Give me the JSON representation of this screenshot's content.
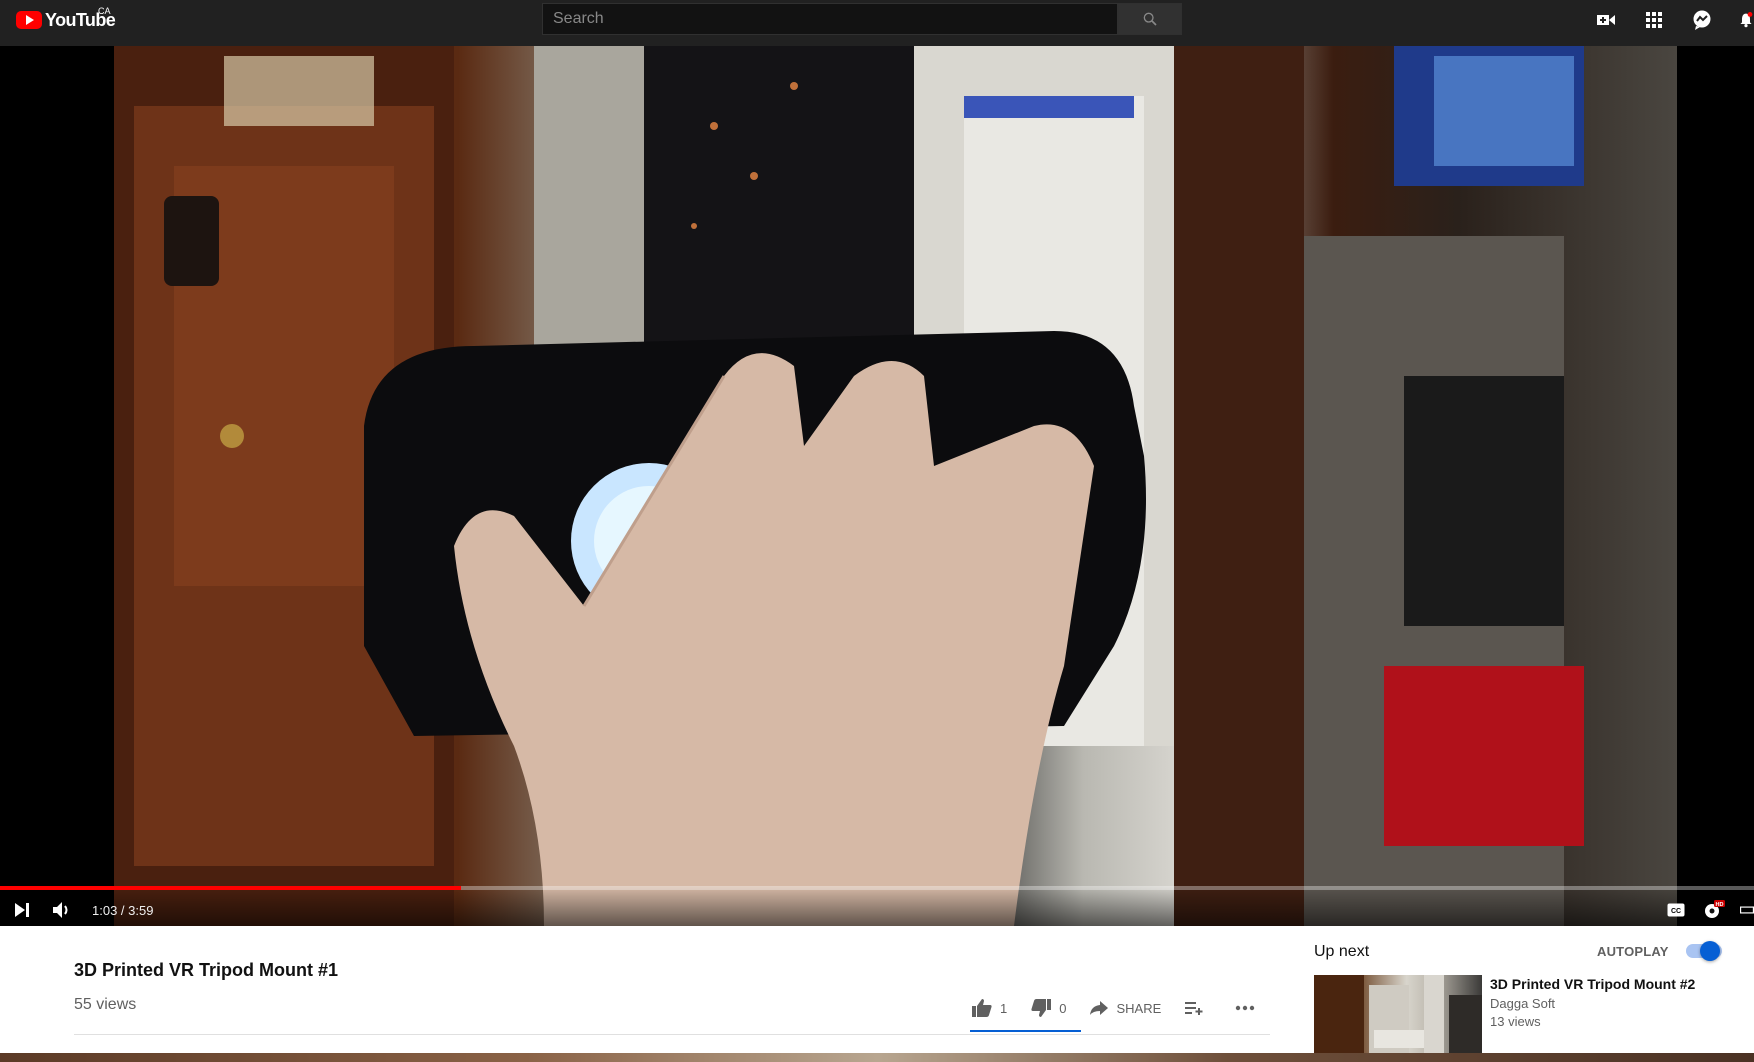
{
  "masthead": {
    "logo_text": "YouTube",
    "region": "CA",
    "search_placeholder": "Search",
    "icons": [
      "video-camera-icon",
      "apps-grid-icon",
      "messages-icon",
      "notifications-bell-icon"
    ]
  },
  "player": {
    "time_display": "1:03 / 3:59",
    "progress": 0.263,
    "colors": {
      "progress": "#ff0000"
    },
    "controls_left": [
      "next-icon",
      "volume-icon"
    ],
    "controls_right": [
      "captions-icon",
      "settings-hd-icon",
      "theater-mode-icon"
    ],
    "settings_badge": "HD"
  },
  "video_info": {
    "title": "3D Printed VR Tripod Mount #1",
    "views": "55 views",
    "likes": "1",
    "dislikes": "0",
    "share_label": "SHARE"
  },
  "upnext": {
    "label": "Up next",
    "autoplay_label": "AUTOPLAY",
    "autoplay_on": true,
    "colors": {
      "accent": "#065fd4"
    },
    "items": [
      {
        "title": "3D Printed VR Tripod Mount #2",
        "channel": "Dagga Soft",
        "views": "13 views"
      }
    ]
  }
}
